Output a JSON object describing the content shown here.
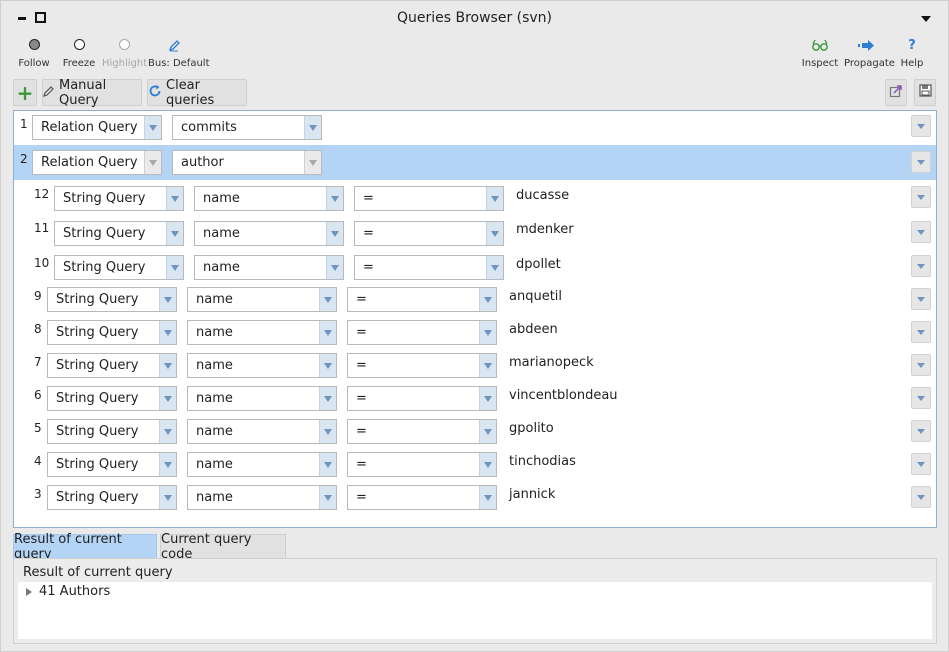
{
  "window": {
    "title": "Queries Browser (svn)"
  },
  "toolbar": {
    "follow": "Follow",
    "freeze": "Freeze",
    "highlight": "Highlight",
    "bus": "Bus: Default",
    "inspect": "Inspect",
    "propagate": "Propagate",
    "help": "Help",
    "help_glyph": "?"
  },
  "actions": {
    "add_glyph": "+",
    "manual_query": "Manual Query",
    "clear_queries": "Clear queries"
  },
  "colors": {
    "accent": "#b3d4f5",
    "green_icon": "#3a9a3a",
    "blue_icon": "#2f7fd0"
  },
  "queries": {
    "r1": {
      "num": "1",
      "type": "Relation Query",
      "param": "commits"
    },
    "r2": {
      "num": "2",
      "type": "Relation Query",
      "param": "author"
    },
    "r12": {
      "num": "12",
      "type": "String Query",
      "field": "name",
      "op": "=",
      "value": "ducasse"
    },
    "r11": {
      "num": "11",
      "type": "String Query",
      "field": "name",
      "op": "=",
      "value": "mdenker"
    },
    "r10": {
      "num": "10",
      "type": "String Query",
      "field": "name",
      "op": "=",
      "value": "dpollet"
    },
    "r9": {
      "num": "9",
      "type": "String Query",
      "field": "name",
      "op": "=",
      "value": "anquetil"
    },
    "r8": {
      "num": "8",
      "type": "String Query",
      "field": "name",
      "op": "=",
      "value": "abdeen"
    },
    "r7": {
      "num": "7",
      "type": "String Query",
      "field": "name",
      "op": "=",
      "value": "marianopeck"
    },
    "r6": {
      "num": "6",
      "type": "String Query",
      "field": "name",
      "op": "=",
      "value": "vincentblondeau"
    },
    "r5": {
      "num": "5",
      "type": "String Query",
      "field": "name",
      "op": "=",
      "value": "gpolito"
    },
    "r4": {
      "num": "4",
      "type": "String Query",
      "field": "name",
      "op": "=",
      "value": "tinchodias"
    },
    "r3": {
      "num": "3",
      "type": "String Query",
      "field": "name",
      "op": "=",
      "value": "jannick"
    }
  },
  "tabs": {
    "result": "Result of current query",
    "code": "Current query code"
  },
  "result": {
    "header": "Result of current query",
    "item": "41 Authors"
  }
}
